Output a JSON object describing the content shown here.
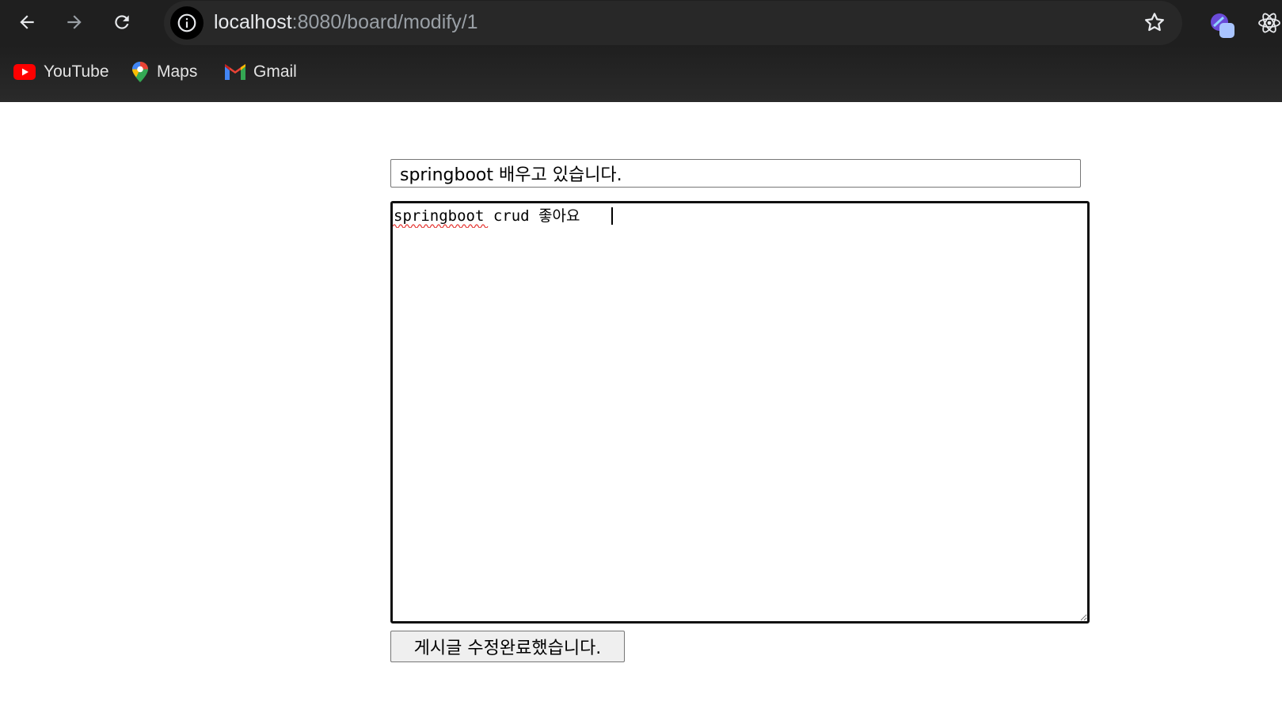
{
  "browser": {
    "url_host": "localhost",
    "url_path": ":8080/board/modify/1",
    "bookmarks": [
      {
        "label": "YouTube",
        "icon": "youtube-icon"
      },
      {
        "label": "Maps",
        "icon": "maps-icon"
      },
      {
        "label": "Gmail",
        "icon": "gmail-icon"
      }
    ],
    "icons": {
      "back": "back-arrow-icon",
      "forward": "forward-arrow-icon",
      "reload": "reload-icon",
      "site_info": "info-icon",
      "bookmark_star": "star-icon",
      "extension_1": "extension-icon",
      "extension_2": "react-icon"
    },
    "colors": {
      "toolbar_bg": "#1f1f1f",
      "omnibox_bg": "#282828",
      "url_host": "#e8eaed",
      "url_path": "#9aa0a6"
    }
  },
  "form": {
    "title_value": "springboot 배우고 있습니다.",
    "content_value": "springboot crud 좋아요 ",
    "submit_label": "게시글 수정완료했습니다."
  }
}
